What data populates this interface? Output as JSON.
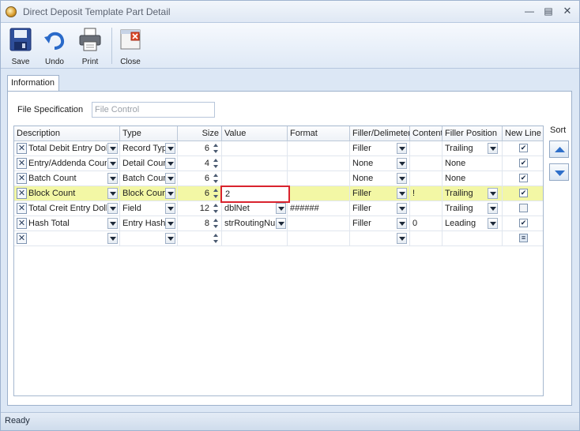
{
  "window": {
    "title": "Direct Deposit Template Part Detail"
  },
  "toolbar": {
    "save_label": "Save",
    "undo_label": "Undo",
    "print_label": "Print",
    "close_label": "Close"
  },
  "tabs": [
    {
      "label": "Information"
    }
  ],
  "file_spec": {
    "label": "File Specification",
    "value": "File Control"
  },
  "grid": {
    "columns": [
      "Description",
      "Type",
      "Size",
      "Value",
      "Format",
      "Filler/Delimeter",
      "Content",
      "Filler Position",
      "New Line"
    ],
    "rows": [
      {
        "description": "Total Debit Entry Dol",
        "type": "Record Typ",
        "size": "6",
        "value": "",
        "format": "",
        "filler": "Filler",
        "content": "",
        "position": "Trailing",
        "new_line": true
      },
      {
        "description": "Entry/Addenda Cour",
        "type": "Detail Cour",
        "size": "4",
        "value": "",
        "format": "",
        "filler": "None",
        "content": "",
        "position": "None",
        "new_line": true
      },
      {
        "description": "Batch Count",
        "type": "Batch Cour",
        "size": "6",
        "value": "",
        "format": "",
        "filler": "None",
        "content": "",
        "position": "None",
        "new_line": true
      },
      {
        "description": "Block Count",
        "type": "Block Count",
        "size": "6",
        "value": "2",
        "format": "",
        "filler": "Filler",
        "content": "!",
        "position": "Trailing",
        "new_line": true
      },
      {
        "description": "Total Creit Entry Doll",
        "type": "Field",
        "size": "12",
        "value": "dblNet",
        "format": "######",
        "filler": "Filler",
        "content": "",
        "position": "Trailing",
        "new_line": false
      },
      {
        "description": "Hash Total",
        "type": "Entry Hash",
        "size": "8",
        "value": "strRoutingNu",
        "format": "",
        "filler": "Filler",
        "content": "0",
        "position": "Leading",
        "new_line": true
      }
    ]
  },
  "sort": {
    "label": "Sort"
  },
  "status": {
    "text": "Ready"
  },
  "colors": {
    "highlight_row": "#f3f7a5",
    "edit_border": "#d9232e"
  }
}
